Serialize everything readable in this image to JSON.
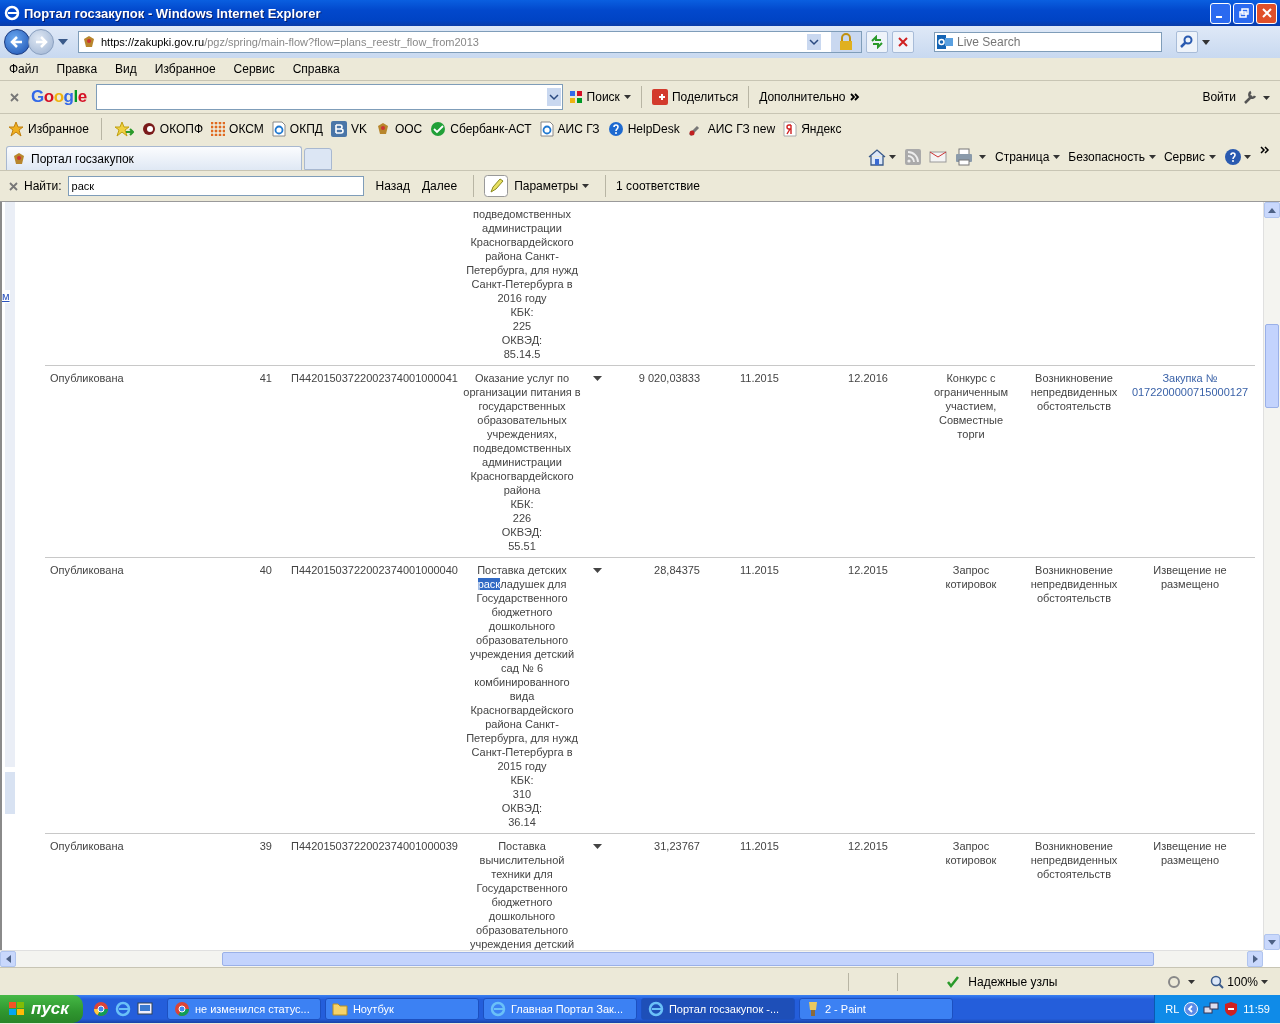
{
  "window": {
    "title": "Портал госзакупок - Windows Internet Explorer"
  },
  "address_bar": {
    "url_host": "https://zakupki.gov.ru",
    "url_path": "/pgz/spring/main-flow?flow=plans_reestr_flow_from2013"
  },
  "search_box": {
    "placeholder": "Live Search"
  },
  "menu": [
    "Файл",
    "Правка",
    "Вид",
    "Избранное",
    "Сервис",
    "Справка"
  ],
  "google_toolbar": {
    "logo": "Google",
    "search_button": "Поиск",
    "share": "Поделиться",
    "more": "Дополнительно",
    "sign_in": "Войти"
  },
  "favorites": {
    "label": "Избранное",
    "links": [
      {
        "label": "ОКОПФ",
        "kind": "swirl"
      },
      {
        "label": "ОКСМ",
        "kind": "grid"
      },
      {
        "label": "ОКПД",
        "kind": "page"
      },
      {
        "label": "VK",
        "kind": "vk"
      },
      {
        "label": "ООС",
        "kind": "crest"
      },
      {
        "label": "Сбербанк-АСТ",
        "kind": "green"
      },
      {
        "label": "АИС ГЗ",
        "kind": "page"
      },
      {
        "label": "HelpDesk",
        "kind": "help"
      },
      {
        "label": "АИС ГЗ new",
        "kind": "tools"
      },
      {
        "label": "Яндекс",
        "kind": "yandex"
      }
    ]
  },
  "tabs": [
    {
      "label": "Портал госзакупок",
      "selected": true
    }
  ],
  "command_bar": [
    "Страница",
    "Безопасность",
    "Сервис"
  ],
  "find_bar": {
    "label": "Найти:",
    "value": "раск",
    "back": "Назад",
    "next": "Далее",
    "options": "Параметры",
    "result": "1 соответствие"
  },
  "side_link": "м",
  "rows": [
    {
      "description": [
        "подведомственных",
        "администрации",
        "Красногвардейского",
        "района Санкт-",
        "Петербурга, для нужд",
        "Санкт-Петербурга в",
        "2016 году",
        "КБК:",
        "225",
        "ОКВЭД:",
        "85.14.5"
      ]
    },
    {
      "status": "Опубликована",
      "number": "41",
      "code": "П44201503722002374001000041",
      "description": [
        "Оказание услуг по",
        "организации питания в",
        "государственных",
        "образовательных",
        "учреждениях,",
        "подведомственных",
        "администрации",
        "Красногвардейского",
        "района",
        "КБК:",
        "226",
        "ОКВЭД:",
        "55.51"
      ],
      "sum": "9 020,03833",
      "start": "11.2015",
      "end": "12.2016",
      "method": "Конкурс с ограниченным участием, Совместные торги",
      "reason": "Возникновение непредвиденных обстоятельств",
      "notice": {
        "text": "Закупка № 0172200000715000127",
        "link": true
      }
    },
    {
      "status": "Опубликована",
      "number": "40",
      "code": "П44201503722002374001000040",
      "description": [
        "Поставка детских",
        [
          {
            "text": "раск",
            "highlighted": true
          },
          {
            "text": "ладушек для",
            "highlighted": false
          }
        ],
        "Государственного",
        "бюджетного",
        "дошкольного",
        "образовательного",
        "учреждения детский",
        "сад № 6",
        "комбинированного",
        "вида",
        "Красногвардейского",
        "района Санкт-",
        "Петербурга, для нужд",
        "Санкт-Петербурга в",
        "2015 году",
        "КБК:",
        "310",
        "ОКВЭД:",
        "36.14"
      ],
      "sum": "28,84375",
      "start": "11.2015",
      "end": "12.2015",
      "method": "Запрос котировок",
      "reason": "Возникновение непредвиденных обстоятельств",
      "notice": {
        "text": "Извещение не размещено",
        "link": false
      }
    },
    {
      "status": "Опубликована",
      "number": "39",
      "code": "П44201503722002374001000039",
      "description": [
        "Поставка",
        "вычислительной",
        "техники для",
        "Государственного",
        "бюджетного",
        "дошкольного",
        "образовательного",
        "учреждения детский"
      ],
      "sum": "31,23767",
      "start": "11.2015",
      "end": "12.2015",
      "method": "Запрос котировок",
      "reason": "Возникновение непредвиденных обстоятельств",
      "notice": {
        "text": "Извещение не размещено",
        "link": false
      }
    }
  ],
  "status_bar": {
    "zone": "Надежные узлы",
    "zoom": "100%"
  },
  "taskbar": {
    "start": "пуск",
    "tasks": [
      {
        "label": "не изменился статус...",
        "kind": "chrome",
        "selected": false
      },
      {
        "label": "Ноутбук",
        "kind": "folder",
        "selected": false
      },
      {
        "label": "Главная Портал Зак...",
        "kind": "ie",
        "selected": false
      },
      {
        "label": "Портал госзакупок -...",
        "kind": "ie",
        "selected": true
      },
      {
        "label": "2 - Paint",
        "kind": "paint",
        "selected": false
      }
    ],
    "language": "RL",
    "clock": "11:59"
  }
}
